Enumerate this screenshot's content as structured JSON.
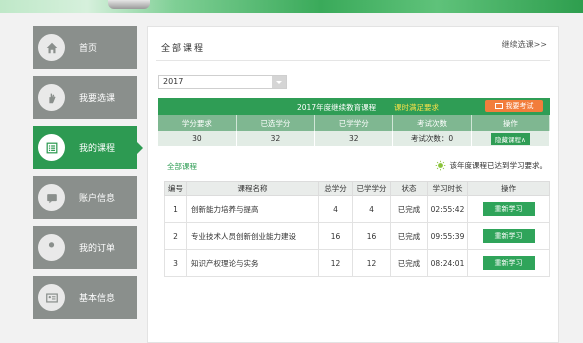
{
  "colors": {
    "accent": "#2d9a52",
    "nav_inactive": "#8a8f8c",
    "exam_orange": "#f27d3c",
    "status_yellow": "#f5e04a"
  },
  "sidebar": {
    "items": [
      {
        "label": "首页",
        "icon": "home-icon"
      },
      {
        "label": "我要选课",
        "icon": "hand-icon"
      },
      {
        "label": "我的课程",
        "icon": "list-icon",
        "active": true
      },
      {
        "label": "账户信息",
        "icon": "message-icon"
      },
      {
        "label": "我的订单",
        "icon": "wrench-icon"
      },
      {
        "label": "基本信息",
        "icon": "id-card-icon"
      }
    ]
  },
  "main": {
    "title": "全部课程",
    "more_link": "继续选课>>",
    "year_select": "2017",
    "summary": {
      "heading": "2017年度继续教育课程",
      "status": "课时满足要求",
      "exam_button": "我要考试",
      "headers": [
        "学分要求",
        "已选学分",
        "已学学分",
        "考试次数",
        "操作"
      ],
      "values": [
        "30",
        "32",
        "32",
        "考试次数：0"
      ],
      "action_button": "隐藏课程∧"
    },
    "all_courses_label": "全部课程",
    "note": "该年度课程已达到学习要求。",
    "table": {
      "headers": [
        "编号",
        "课程名称",
        "总学分",
        "已学学分",
        "状态",
        "学习时长",
        "操作"
      ],
      "rows": [
        {
          "id": "1",
          "name": "创新能力培养与提高",
          "total": "4",
          "learned": "4",
          "status": "已完成",
          "duration": "02:55:42",
          "action": "重新学习"
        },
        {
          "id": "2",
          "name": "专业技术人员创新创业能力建设",
          "total": "16",
          "learned": "16",
          "status": "已完成",
          "duration": "09:55:39",
          "action": "重新学习"
        },
        {
          "id": "3",
          "name": "知识产权理论与实务",
          "total": "12",
          "learned": "12",
          "status": "已完成",
          "duration": "08:24:01",
          "action": "重新学习"
        }
      ]
    }
  }
}
